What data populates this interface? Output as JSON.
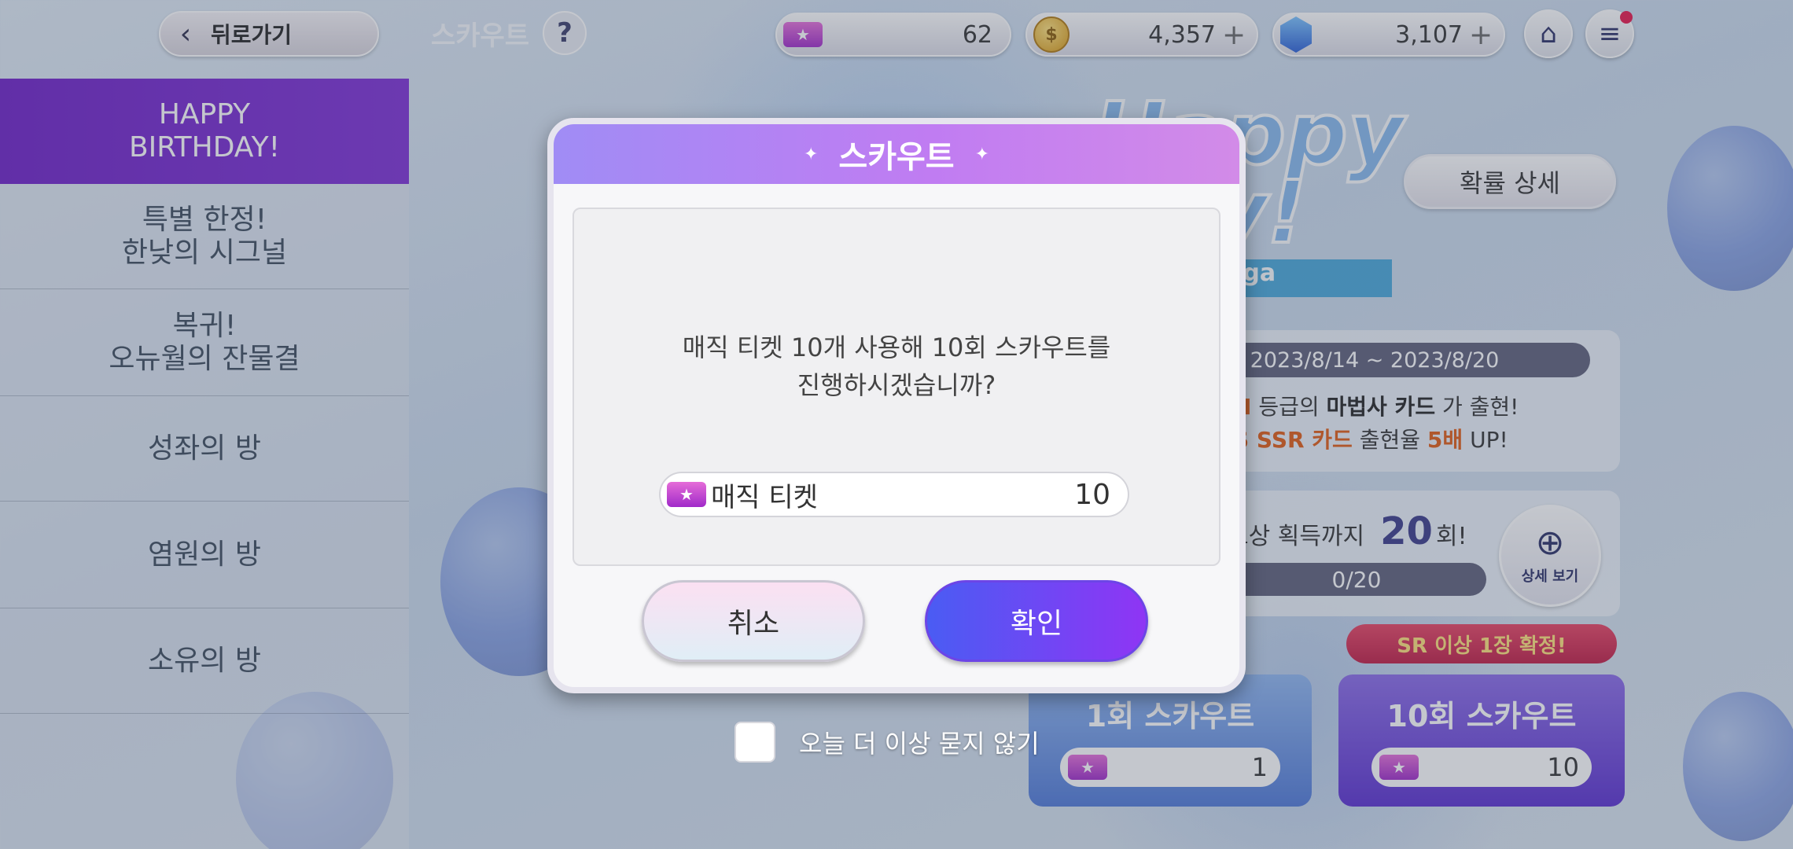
{
  "top_bar": {
    "back_label": "뒤로가기",
    "scene_title": "스카우트",
    "help_symbol": "?",
    "resources": [
      {
        "icon": "magic-ticket-icon",
        "value": "62"
      },
      {
        "icon": "gold-coin-icon",
        "value": "4,357",
        "has_plus": true
      },
      {
        "icon": "blue-gem-icon",
        "value": "3,107",
        "has_plus": true
      }
    ],
    "home_icon": "home-icon",
    "menu_icon": "hamburger-menu-icon",
    "menu_has_notification": true
  },
  "sidebar": {
    "items": [
      {
        "label": "HAPPY\nBIRTHDAY!",
        "active": true
      },
      {
        "label": "특별 한정!\n한낮의 시그널",
        "active": false
      },
      {
        "label": "복귀!\n오뉴월의 잔물결",
        "active": false
      },
      {
        "label": "성좌의 방",
        "active": false
      },
      {
        "label": "염원의 방",
        "active": false
      },
      {
        "label": "소유의 방",
        "active": false
      }
    ]
  },
  "banner": {
    "logo_text": "Happy\nday!",
    "logo_ribbon": "ega",
    "probability_button": "확률 상세",
    "period": ": 2023/8/14 ~ 2023/8/20",
    "line1_a": "N",
    "line1_b": " 등급의 ",
    "line1_c": "마법사 카드",
    "line1_d": " 가 출현!",
    "line2_a": "S SSR 카드",
    "line2_b": " 출현율 ",
    "line2_c": "5배",
    "line2_d": " UP!",
    "reward_text": "보상 획득까지",
    "reward_count": "20",
    "reward_suffix": "회!",
    "progress_text": "0/20",
    "progress": 0,
    "detail_label": "상세 보기",
    "sr_badge": "SR 이상 1장 확정!",
    "scout_one_label": "1회 스카우트",
    "scout_one_cost": "1",
    "scout_ten_label": "10회 스카우트",
    "scout_ten_cost": "10"
  },
  "dialog": {
    "title": "스카우트",
    "message": "매직 티켓 10개 사용해 10회 스카우트를\n진행하시겠습니까?",
    "cost_label": "매직 티켓",
    "cost_value": "10",
    "cancel_label": "취소",
    "confirm_label": "확인",
    "dont_ask_label": "오늘 더 이상 묻지 않기",
    "dont_ask_checked": false
  },
  "colors": {
    "accent_purple": "#7e2fd6",
    "confirm_gradient_start": "#4a5cf3",
    "confirm_gradient_end": "#8f35f4",
    "highlight_orange": "#e05a12",
    "badge_red": "#c01b44"
  }
}
